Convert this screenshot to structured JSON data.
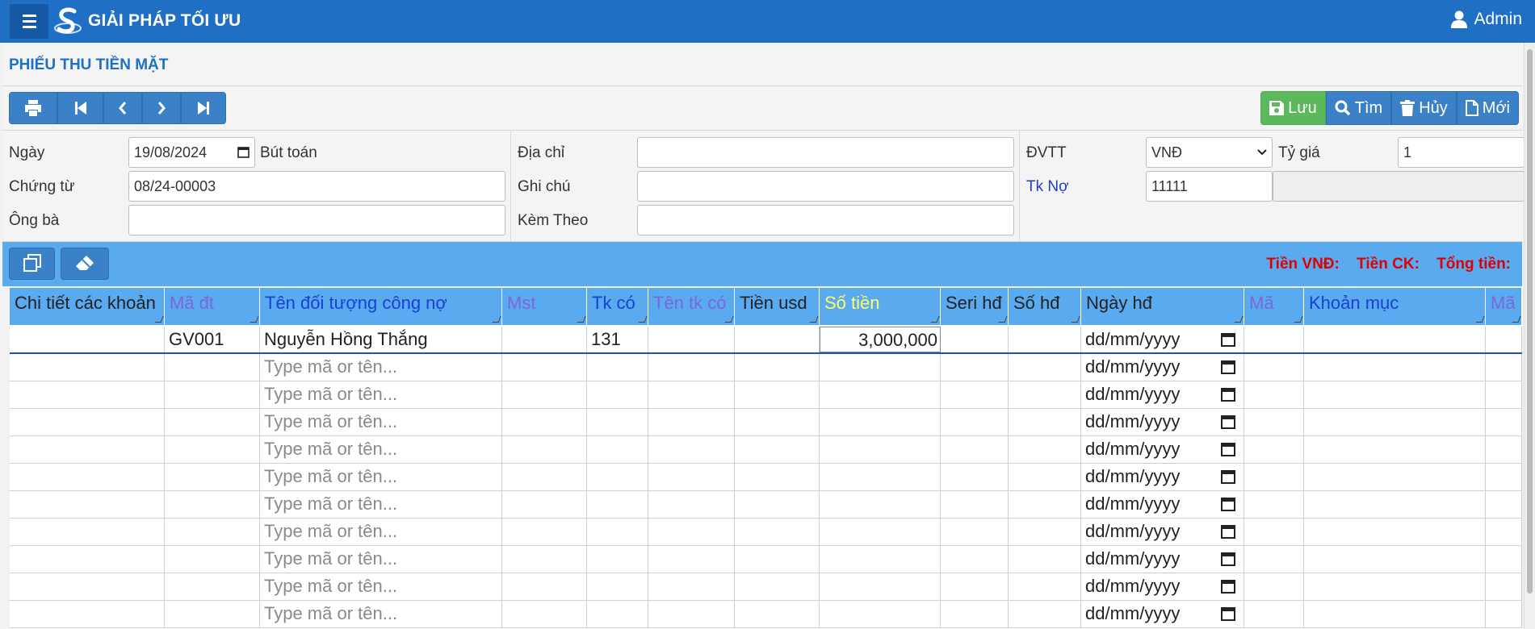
{
  "app": {
    "brand": "GIẢI PHÁP TỐI ƯU",
    "user": "Admin"
  },
  "page": {
    "title": "PHIẾU THU TIỀN MẶT"
  },
  "actions": {
    "save": "Lưu",
    "find": "Tìm",
    "cancel": "Hủy",
    "new": "Mới"
  },
  "form": {
    "ngay_label": "Ngày",
    "ngay_value": "19/08/2024",
    "but_toan_label": "Bút toán",
    "chung_tu_label": "Chứng từ",
    "chung_tu_value": "08/24-00003",
    "ong_ba_label": "Ông bà",
    "ong_ba_value": "",
    "dia_chi_label": "Địa chỉ",
    "dia_chi_value": "",
    "ghi_chu_label": "Ghi chú",
    "ghi_chu_value": "",
    "kem_theo_label": "Kèm Theo",
    "kem_theo_value": "",
    "dvtt_label": "ĐVTT",
    "dvtt_value": "VNĐ",
    "ty_gia_label": "Tỷ giá",
    "ty_gia_value": "1",
    "tk_no_label": "Tk Nợ",
    "tk_no_value": "11111",
    "tk_no_name": ""
  },
  "totals": {
    "tien_vnd": "Tiền VNĐ:",
    "tien_ck": "Tiền CK:",
    "tong_tien": "Tổng tiền:"
  },
  "grid": {
    "columns": [
      {
        "label": "Chi tiết các khoản",
        "color": "#222222"
      },
      {
        "label": "Mã đt",
        "color": "#7b68d8"
      },
      {
        "label": "Tên đối tượng công nợ",
        "color": "#1a3fd6"
      },
      {
        "label": "Mst",
        "color": "#7b68d8"
      },
      {
        "label": "Tk có",
        "color": "#1a3fd6"
      },
      {
        "label": "Tên tk có",
        "color": "#7b68d8"
      },
      {
        "label": "Tiền usd",
        "color": "#222222"
      },
      {
        "label": "Số tiền",
        "color": "#ffff66"
      },
      {
        "label": "Seri hđ",
        "color": "#222222"
      },
      {
        "label": "Số hđ",
        "color": "#222222"
      },
      {
        "label": "Ngày hđ",
        "color": "#222222"
      },
      {
        "label": "Mã",
        "color": "#7b68d8"
      },
      {
        "label": "Khoản mục",
        "color": "#1a3fd6"
      },
      {
        "label": "Mã",
        "color": "#7b68d8"
      }
    ],
    "first_row": {
      "ma_dt": "GV001",
      "ten_doi_tuong": "Nguyễn Hồng Thắng",
      "tk_co": "131",
      "so_tien": "3,000,000",
      "ngay_hd": "dd/mm/yyyy"
    },
    "placeholder_name": "Type mã or tên...",
    "placeholder_date": "dd/mm/yyyy"
  }
}
